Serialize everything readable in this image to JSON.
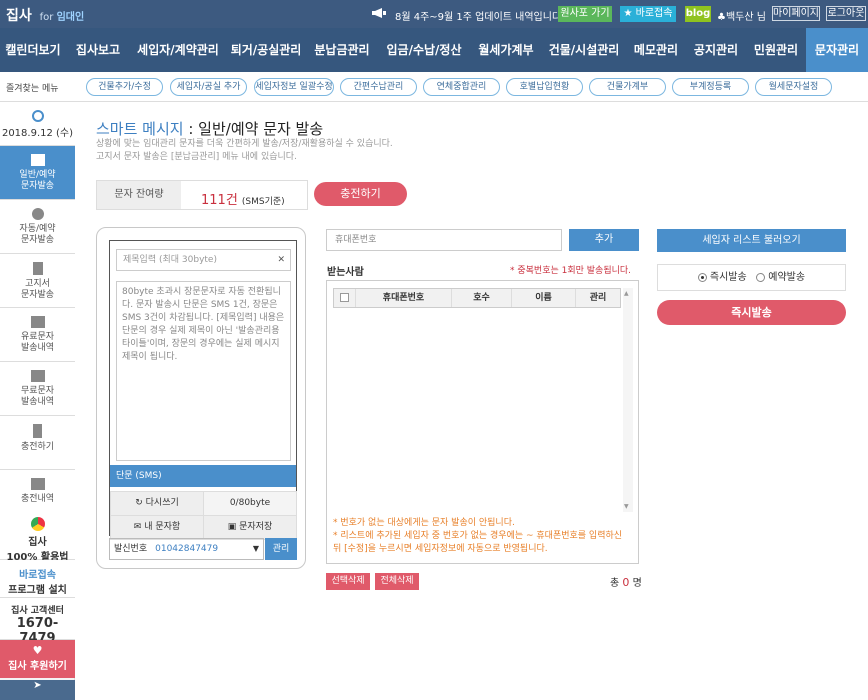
{
  "topbar": {
    "logo": "집사",
    "logo_for": "for",
    "logo_sub": "임대인",
    "notice": "8월 4주~9월 1주 업데이트 내역입니다~",
    "remote_btn": "원사포 가기",
    "quick_btn": "★ 바로접속",
    "blog": "blog",
    "user": "♣백두산 님",
    "mypage": "마이페이지",
    "logout": "로그아웃"
  },
  "nav": {
    "items": [
      "캘린더보기",
      "집사보고",
      "세입자/계약관리",
      "퇴거/공실관리",
      "분납금관리",
      "입금/수납/정산",
      "월세가계부",
      "건물/시설관리",
      "메모관리",
      "공지관리",
      "민원관리",
      "문자관리"
    ]
  },
  "quick": {
    "label": "즐겨찾는 메뉴",
    "items": [
      "건물추가/수정",
      "세입자/공실 추가",
      "세입자정보 일괄수정",
      "간편수납관리",
      "연체중합관리",
      "호별납입현황",
      "건물가계부",
      "부계정등록",
      "월세문자설정"
    ]
  },
  "sidebar": {
    "date": "2018.9.12 (수)",
    "items": [
      {
        "label1": "일반/예약",
        "label2": "문자발송"
      },
      {
        "label1": "자동/예약",
        "label2": "문자발송"
      },
      {
        "label1": "고지서",
        "label2": "문자발송"
      },
      {
        "label1": "유료문자",
        "label2": "발송내역"
      },
      {
        "label1": "무료문자",
        "label2": "발송내역"
      },
      {
        "label1": "충전하기",
        "label2": ""
      },
      {
        "label1": "충전내역",
        "label2": ""
      }
    ],
    "promo1_a": "집사",
    "promo1_b": "100% 활용법",
    "promo2_a": "바로접속",
    "promo2_b": "프로그램 설치",
    "cs_title": "집사 고객센터",
    "cs_phone": "1670-7479",
    "support": "집사 후원하기"
  },
  "content": {
    "title_hl": "스마트 메시지",
    "title_rest": " : 일반/예약 문자 발송",
    "desc1": "상황에 맞는 임대관리 문자를 더욱 간편하게 발송/저장/재활용하실 수 있습니다.",
    "desc2": "고지서 문자 발송은 [분납금관리] 메뉴 내에 있습니다.",
    "remain_label": "문자 잔여량",
    "remain_val": "111건",
    "remain_unit": "(SMS기준)",
    "charge": "충전하기"
  },
  "phone": {
    "title_placeholder": "제목입력 (최대 30byte)",
    "close": "✕",
    "body_placeholder": "80byte 초과시 장문문자로 자동 전환됩니다. 문자 발송시 단문은 SMS 1건, 장문은 SMS 3건이 차감됩니다. [제목입력] 내용은 단문의 경우 실제 제목이 아닌 '발송관리용 타이틀'이며, 장문의 경우에는 실제 메시지 제목이 됩니다.",
    "sms_type": "단문 (SMS)",
    "rewrite": "다시쓰기",
    "bytes": "0/80byte",
    "my_msgs": "내 문자함",
    "save_msg": "문자저장",
    "sender_label": "발신번호",
    "sender_num": "01042847479",
    "sender_caret": "▼",
    "sender_manage": "관리"
  },
  "recv": {
    "phone_placeholder": "휴대폰번호",
    "add": "추가",
    "label": "받는사람",
    "dup_note": "* 중복번호는 1회만 발송됩니다.",
    "headers": [
      "휴대폰번호",
      "호수",
      "이름",
      "관리"
    ],
    "note1": "* 번호가 없는 대상에게는 문자 발송이 안됩니다.",
    "note2": "* 리스트에 추가된 세입자 중 번호가 없는 경우에는 ~ 휴대폰번호를 입력하신 뒤 [수정]을 누르시면 세입자정보에 자동으로 반영됩니다.",
    "del_selected": "선택삭제",
    "del_all": "전체삭제",
    "total_pre": "총",
    "total_n": "0",
    "total_post": "명"
  },
  "right": {
    "load": "세입자 리스트 불러오기",
    "opt_now": "즉시발송",
    "opt_reserve": "예약발송",
    "send": "즉시발송"
  }
}
